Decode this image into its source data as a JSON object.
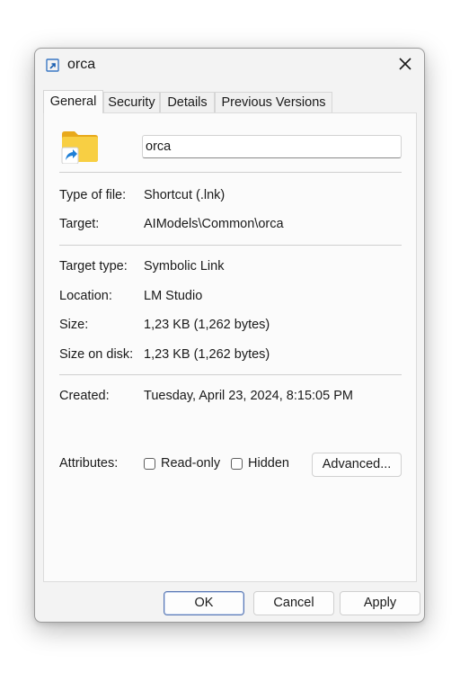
{
  "window": {
    "title": "orca",
    "close_icon": "close-icon",
    "title_icon": "shortcut-icon"
  },
  "tabs": [
    {
      "label": "General",
      "active": true
    },
    {
      "label": "Security",
      "active": false
    },
    {
      "label": "Details",
      "active": false
    },
    {
      "label": "Previous Versions",
      "active": false
    }
  ],
  "general": {
    "file_icon": "folder-shortcut-icon",
    "name_value": "orca",
    "type_of_file": {
      "label": "Type of file:",
      "value": "Shortcut (.lnk)"
    },
    "target": {
      "label": "Target:",
      "value": "AIModels\\Common\\orca"
    },
    "target_type": {
      "label": "Target type:",
      "value": "Symbolic Link"
    },
    "location": {
      "label": "Location:",
      "value": "LM Studio"
    },
    "size": {
      "label": "Size:",
      "value": "1,23 KB (1,262 bytes)"
    },
    "size_on_disk": {
      "label": "Size on disk:",
      "value": "1,23 KB (1,262 bytes)"
    },
    "created": {
      "label": "Created:",
      "value": "Tuesday, April 23, 2024, 8:15:05 PM"
    },
    "attributes": {
      "label": "Attributes:",
      "read_only": {
        "label": "Read-only",
        "checked": false
      },
      "hidden": {
        "label": "Hidden",
        "checked": false
      },
      "advanced_label": "Advanced..."
    }
  },
  "footer": {
    "ok_label": "OK",
    "cancel_label": "Cancel",
    "apply_label": "Apply"
  },
  "colors": {
    "accent": "#0067c0",
    "folder_yellow": "#f4c430",
    "primary_button_border": "#5a78b4"
  }
}
